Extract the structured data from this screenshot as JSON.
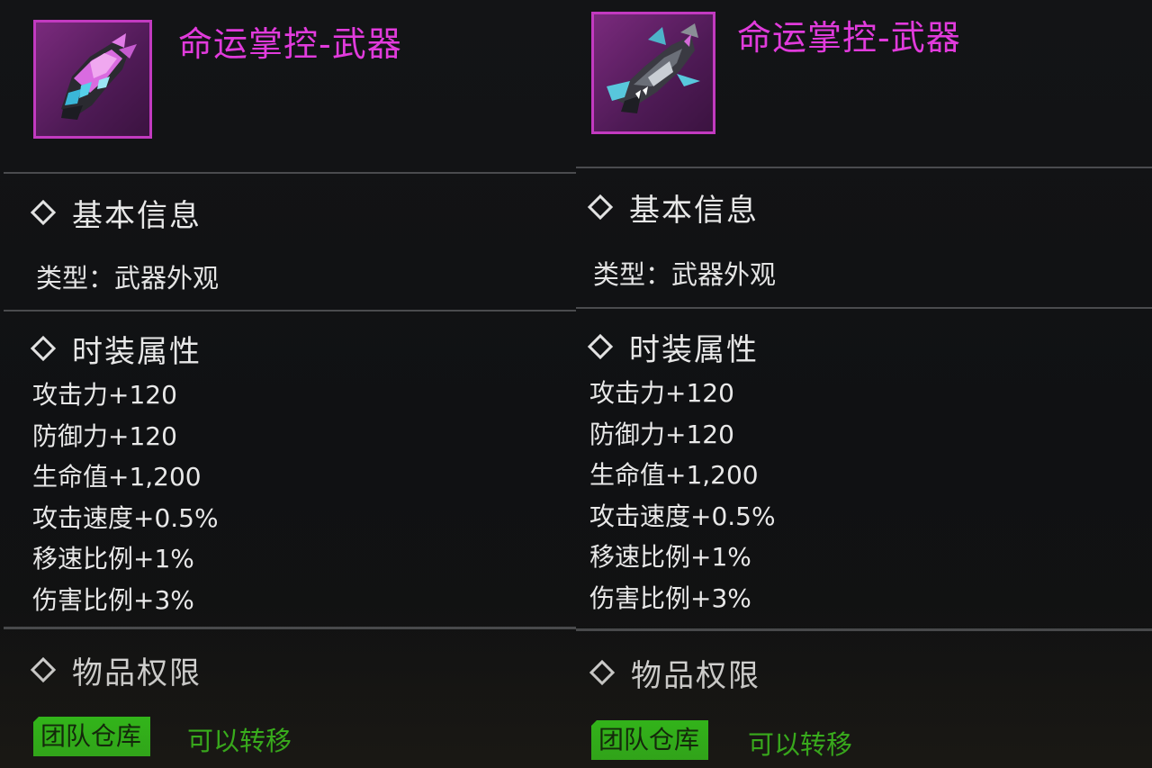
{
  "panels": [
    {
      "title": "命运掌控-武器",
      "weapon_icon": "glove-gauntlet-icon",
      "basic_info": {
        "heading": "基本信息",
        "type_label": "类型：",
        "type_value": "武器外观"
      },
      "attributes": {
        "heading": "时装属性",
        "stats": [
          "攻击力+120",
          "防御力+120",
          "生命值+1,200",
          "攻击速度+0.5%",
          "移速比例+1%",
          "伤害比例+3%"
        ]
      },
      "permissions": {
        "heading": "物品权限",
        "badge": "团队仓库",
        "status": "可以转移"
      }
    },
    {
      "title": "命运掌控-武器",
      "weapon_icon": "shark-cannon-icon",
      "basic_info": {
        "heading": "基本信息",
        "type_label": "类型：",
        "type_value": "武器外观"
      },
      "attributes": {
        "heading": "时装属性",
        "stats": [
          "攻击力+120",
          "防御力+120",
          "生命值+1,200",
          "攻击速度+0.5%",
          "移速比例+1%",
          "伤害比例+3%"
        ]
      },
      "permissions": {
        "heading": "物品权限",
        "badge": "团队仓库",
        "status": "可以转移"
      }
    }
  ],
  "colors": {
    "rarity_purple": "#c23ac0",
    "title_magenta": "#e13bdc",
    "badge_green": "#35e21a",
    "status_green": "#3fe01e"
  }
}
